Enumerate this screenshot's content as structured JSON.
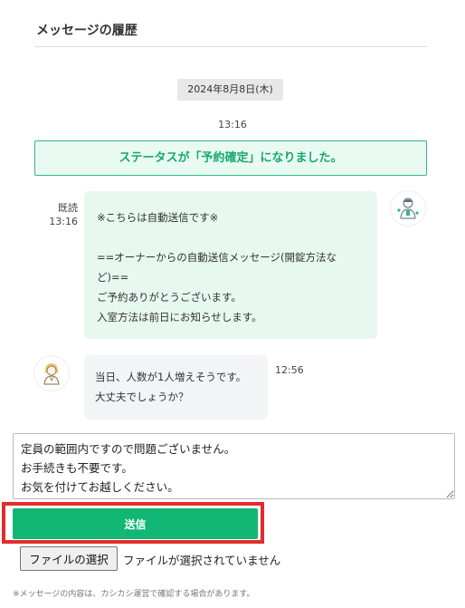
{
  "header": {
    "title": "メッセージの履歴"
  },
  "thread": {
    "date": "2024年8月8日(木)",
    "time": "13:16",
    "status_banner": "ステータスが「予約確定」になりました。",
    "owner_message": {
      "read_label": "既読",
      "time": "13:16",
      "text": "※こちらは自動送信です※\n\n==オーナーからの自動送信メッセージ(開錠方法など)==\nご予約ありがとうございます。\n入室方法は前日にお知らせします。",
      "avatar_icon": "owner-avatar-icon"
    },
    "guest_message": {
      "time": "12:56",
      "text": "当日、人数が1人増えそうです。\n大丈夫でしょうか？",
      "avatar_icon": "guest-avatar-icon"
    }
  },
  "composer": {
    "value": "定員の範囲内ですので問題ございません。\nお手続きも不要です。\nお気を付けてお越しください。",
    "send_label": "送信",
    "file_button_label": "ファイルの選択",
    "file_status": "ファイルが選択されていません"
  },
  "footer": {
    "note": "※メッセージの内容は、カシカシ運営で確認する場合があります。"
  },
  "colors": {
    "accent": "#12b675",
    "status_text": "#17a86e",
    "status_bg": "#e9faf3",
    "owner_bubble": "#e7f8f0",
    "guest_bubble": "#f3f4f5",
    "highlight": "#e12d2d"
  }
}
